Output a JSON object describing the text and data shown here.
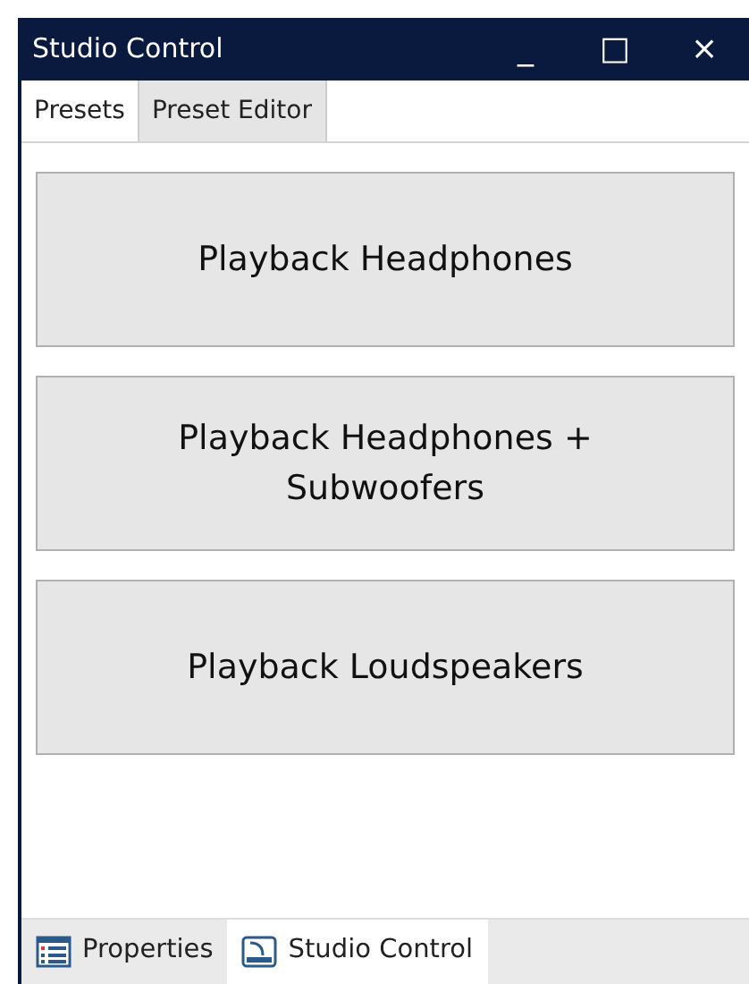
{
  "window": {
    "title": "Studio Control",
    "controls": [
      "_",
      "□",
      "×"
    ]
  },
  "tabs": [
    {
      "label": "Presets",
      "selected": true
    },
    {
      "label": "Preset Editor",
      "selected": false
    }
  ],
  "presets": [
    {
      "label": "Playback Headphones"
    },
    {
      "label": "Playback Headphones + Subwoofers"
    },
    {
      "label": "Playback Loudspeakers"
    }
  ],
  "bottom_tabs": [
    {
      "label": "Properties",
      "selected": false
    },
    {
      "label": "Studio Control",
      "selected": true
    }
  ]
}
